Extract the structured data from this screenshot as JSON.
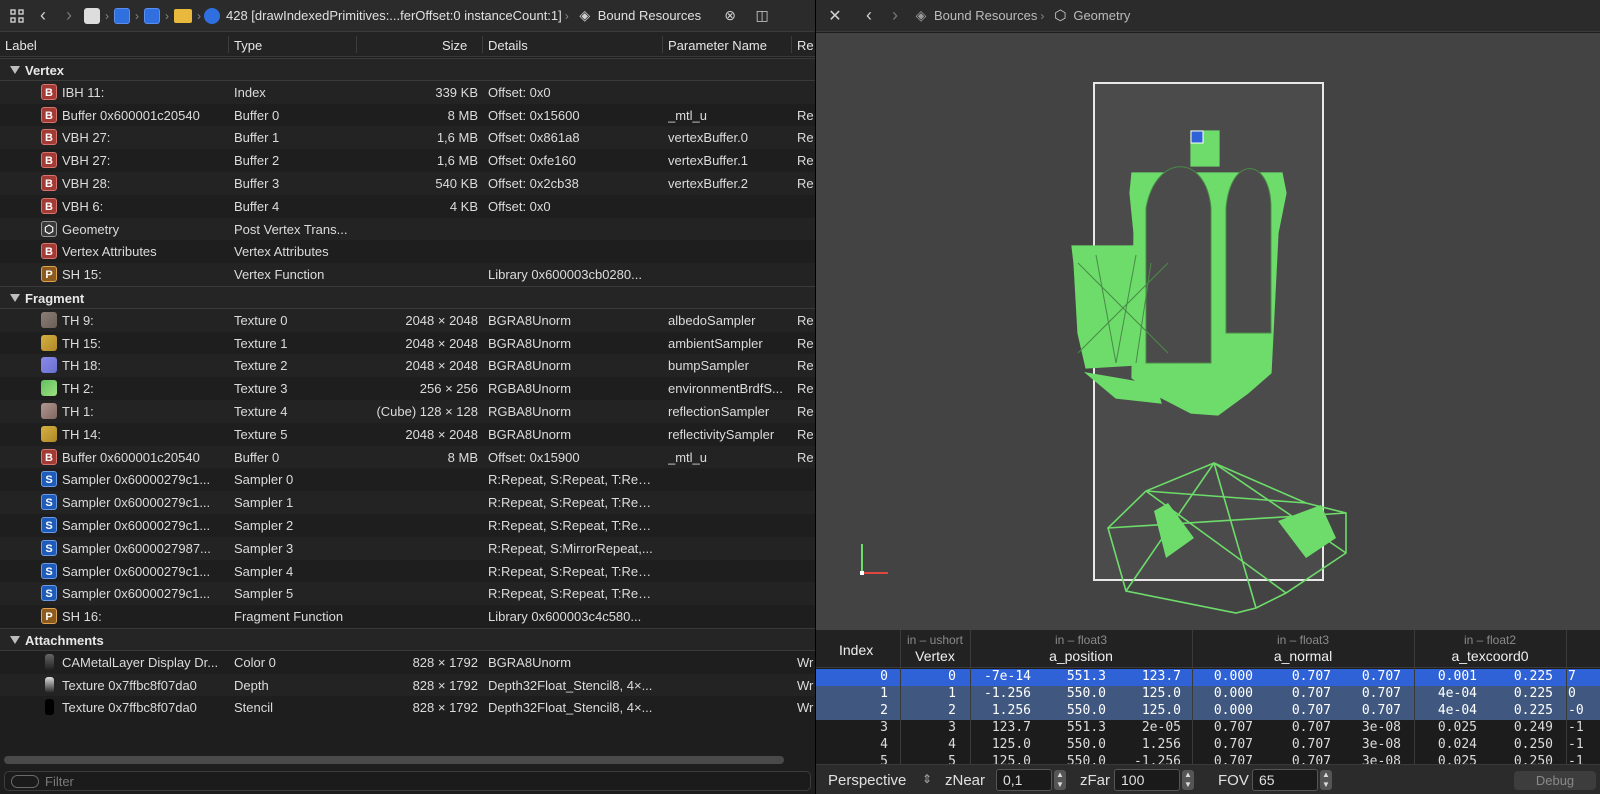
{
  "left": {
    "toolbar": {
      "call_label": "428 [drawIndexedPrimitives:...ferOffset:0 instanceCount:1]",
      "bound_label": "Bound Resources"
    },
    "columns": {
      "label": "Label",
      "type": "Type",
      "size": "Size",
      "details": "Details",
      "param": "Parameter Name",
      "re": "Re"
    },
    "groups": [
      {
        "title": "Vertex",
        "rows": [
          {
            "badge": "B",
            "label": "IBH 11:",
            "type": "Index",
            "size": "339 KB",
            "details": "Offset: 0x0",
            "param": "",
            "re": ""
          },
          {
            "badge": "B",
            "label": "Buffer 0x600001c20540",
            "type": "Buffer 0",
            "size": "8 MB",
            "details": "Offset: 0x15600",
            "param": "_mtl_u",
            "re": "Re"
          },
          {
            "badge": "B",
            "label": "VBH 27:",
            "type": "Buffer 1",
            "size": "1,6 MB",
            "details": "Offset: 0x861a8",
            "param": "vertexBuffer.0",
            "re": "Re"
          },
          {
            "badge": "B",
            "label": "VBH 27:",
            "type": "Buffer 2",
            "size": "1,6 MB",
            "details": "Offset: 0xfe160",
            "param": "vertexBuffer.1",
            "re": "Re"
          },
          {
            "badge": "B",
            "label": "VBH 28:",
            "type": "Buffer 3",
            "size": "540 KB",
            "details": "Offset: 0x2cb38",
            "param": "vertexBuffer.2",
            "re": "Re"
          },
          {
            "badge": "B",
            "label": "VBH 6:",
            "type": "Buffer 4",
            "size": "4 KB",
            "details": "Offset: 0x0",
            "param": "",
            "re": ""
          },
          {
            "badge": "G",
            "label": "Geometry",
            "type": "Post Vertex Trans...",
            "size": "",
            "details": "",
            "param": "",
            "re": ""
          },
          {
            "badge": "B",
            "label": "Vertex Attributes",
            "type": "Vertex Attributes",
            "size": "",
            "details": "",
            "param": "",
            "re": ""
          },
          {
            "badge": "P",
            "label": "SH 15:",
            "type": "Vertex Function",
            "size": "",
            "details": "Library 0x600003cb0280...",
            "param": "",
            "re": ""
          }
        ]
      },
      {
        "title": "Fragment",
        "rows": [
          {
            "badge": "T1",
            "label": "TH 9:",
            "type": "Texture 0",
            "size": "2048 × 2048",
            "details": "BGRA8Unorm",
            "param": "albedoSampler",
            "re": "Re"
          },
          {
            "badge": "T2",
            "label": "TH 15:",
            "type": "Texture 1",
            "size": "2048 × 2048",
            "details": "BGRA8Unorm",
            "param": "ambientSampler",
            "re": "Re"
          },
          {
            "badge": "T3",
            "label": "TH 18:",
            "type": "Texture 2",
            "size": "2048 × 2048",
            "details": "BGRA8Unorm",
            "param": "bumpSampler",
            "re": "Re"
          },
          {
            "badge": "T4",
            "label": "TH 2:",
            "type": "Texture 3",
            "size": "256 × 256",
            "details": "RGBA8Unorm",
            "param": "environmentBrdfS...",
            "re": "Re"
          },
          {
            "badge": "T5",
            "label": "TH 1:",
            "type": "Texture 4",
            "size": "(Cube) 128 × 128",
            "details": "RGBA8Unorm",
            "param": "reflectionSampler",
            "re": "Re"
          },
          {
            "badge": "T2",
            "label": "TH 14:",
            "type": "Texture 5",
            "size": "2048 × 2048",
            "details": "BGRA8Unorm",
            "param": "reflectivitySampler",
            "re": "Re"
          },
          {
            "badge": "B",
            "label": "Buffer 0x600001c20540",
            "type": "Buffer 0",
            "size": "8 MB",
            "details": "Offset: 0x15900",
            "param": "_mtl_u",
            "re": "Re"
          },
          {
            "badge": "S",
            "label": "Sampler 0x60000279c1...",
            "type": "Sampler 0",
            "size": "",
            "details": "R:Repeat, S:Repeat, T:Rep...",
            "param": "",
            "re": ""
          },
          {
            "badge": "S",
            "label": "Sampler 0x60000279c1...",
            "type": "Sampler 1",
            "size": "",
            "details": "R:Repeat, S:Repeat, T:Rep...",
            "param": "",
            "re": ""
          },
          {
            "badge": "S",
            "label": "Sampler 0x60000279c1...",
            "type": "Sampler 2",
            "size": "",
            "details": "R:Repeat, S:Repeat, T:Rep...",
            "param": "",
            "re": ""
          },
          {
            "badge": "S",
            "label": "Sampler 0x6000027987...",
            "type": "Sampler 3",
            "size": "",
            "details": "R:Repeat, S:MirrorRepeat,...",
            "param": "",
            "re": ""
          },
          {
            "badge": "S",
            "label": "Sampler 0x60000279c1...",
            "type": "Sampler 4",
            "size": "",
            "details": "R:Repeat, S:Repeat, T:Rep...",
            "param": "",
            "re": ""
          },
          {
            "badge": "S",
            "label": "Sampler 0x60000279c1...",
            "type": "Sampler 5",
            "size": "",
            "details": "R:Repeat, S:Repeat, T:Rep...",
            "param": "",
            "re": ""
          },
          {
            "badge": "P",
            "label": "SH 16:",
            "type": "Fragment Function",
            "size": "",
            "details": "Library 0x600003c4c580...",
            "param": "",
            "re": ""
          }
        ]
      },
      {
        "title": "Attachments",
        "rows": [
          {
            "badge": "A1",
            "label": "CAMetalLayer Display Dr...",
            "type": "Color 0",
            "size": "828 × 1792",
            "details": "BGRA8Unorm",
            "param": "",
            "re": "Wr"
          },
          {
            "badge": "A2",
            "label": "Texture 0x7ffbc8f07da0",
            "type": "Depth",
            "size": "828 × 1792",
            "details": "Depth32Float_Stencil8, 4×...",
            "param": "",
            "re": "Wr"
          },
          {
            "badge": "A3",
            "label": "Texture 0x7ffbc8f07da0",
            "type": "Stencil",
            "size": "828 × 1792",
            "details": "Depth32Float_Stencil8, 4×...",
            "param": "",
            "re": "Wr"
          }
        ]
      }
    ],
    "filter_placeholder": "Filter"
  },
  "right": {
    "toolbar": {
      "crumb1": "Bound Resources",
      "crumb2": "Geometry"
    },
    "table": {
      "index_header": "Index",
      "columns": [
        {
          "sub": "in – ushort",
          "name": "Vertex"
        },
        {
          "sub": "in – float3",
          "name": "a_position"
        },
        {
          "sub": "in – float3",
          "name": "a_normal"
        },
        {
          "sub": "in – float2",
          "name": "a_texcoord0"
        }
      ],
      "rows": [
        {
          "index": "0",
          "vertex": "0",
          "pos": [
            "-7e-14",
            "551.3",
            "123.7"
          ],
          "normal": [
            "0.000",
            "0.707",
            "0.707"
          ],
          "tex": [
            "0.001",
            "0.225"
          ],
          "extra": "7",
          "state": "selected"
        },
        {
          "index": "1",
          "vertex": "1",
          "pos": [
            "-1.256",
            "550.0",
            "125.0"
          ],
          "normal": [
            "0.000",
            "0.707",
            "0.707"
          ],
          "tex": [
            "4e-04",
            "0.225"
          ],
          "extra": "0",
          "state": "highlight"
        },
        {
          "index": "2",
          "vertex": "2",
          "pos": [
            "1.256",
            "550.0",
            "125.0"
          ],
          "normal": [
            "0.000",
            "0.707",
            "0.707"
          ],
          "tex": [
            "4e-04",
            "0.225"
          ],
          "extra": "-0",
          "state": "highlight"
        },
        {
          "index": "3",
          "vertex": "3",
          "pos": [
            "123.7",
            "551.3",
            "2e-05"
          ],
          "normal": [
            "0.707",
            "0.707",
            "3e-08"
          ],
          "tex": [
            "0.025",
            "0.249"
          ],
          "extra": "-1",
          "state": ""
        },
        {
          "index": "4",
          "vertex": "4",
          "pos": [
            "125.0",
            "550.0",
            "1.256"
          ],
          "normal": [
            "0.707",
            "0.707",
            "3e-08"
          ],
          "tex": [
            "0.024",
            "0.250"
          ],
          "extra": "-1",
          "state": ""
        },
        {
          "index": "5",
          "vertex": "5",
          "pos": [
            "125.0",
            "550.0",
            "-1.256"
          ],
          "normal": [
            "0.707",
            "0.707",
            "3e-08"
          ],
          "tex": [
            "0.025",
            "0.250"
          ],
          "extra": "-1",
          "state": ""
        }
      ]
    },
    "bottom": {
      "projection": "Perspective",
      "znear_label": "zNear",
      "znear_value": "0,1",
      "zfar_label": "zFar",
      "zfar_value": "100",
      "fov_label": "FOV",
      "fov_value": "65",
      "debug_label": "Debug"
    }
  },
  "colors": {
    "accent": "#2f62d6",
    "mesh": "#6ddc6a",
    "background": "#1e1e1e"
  }
}
